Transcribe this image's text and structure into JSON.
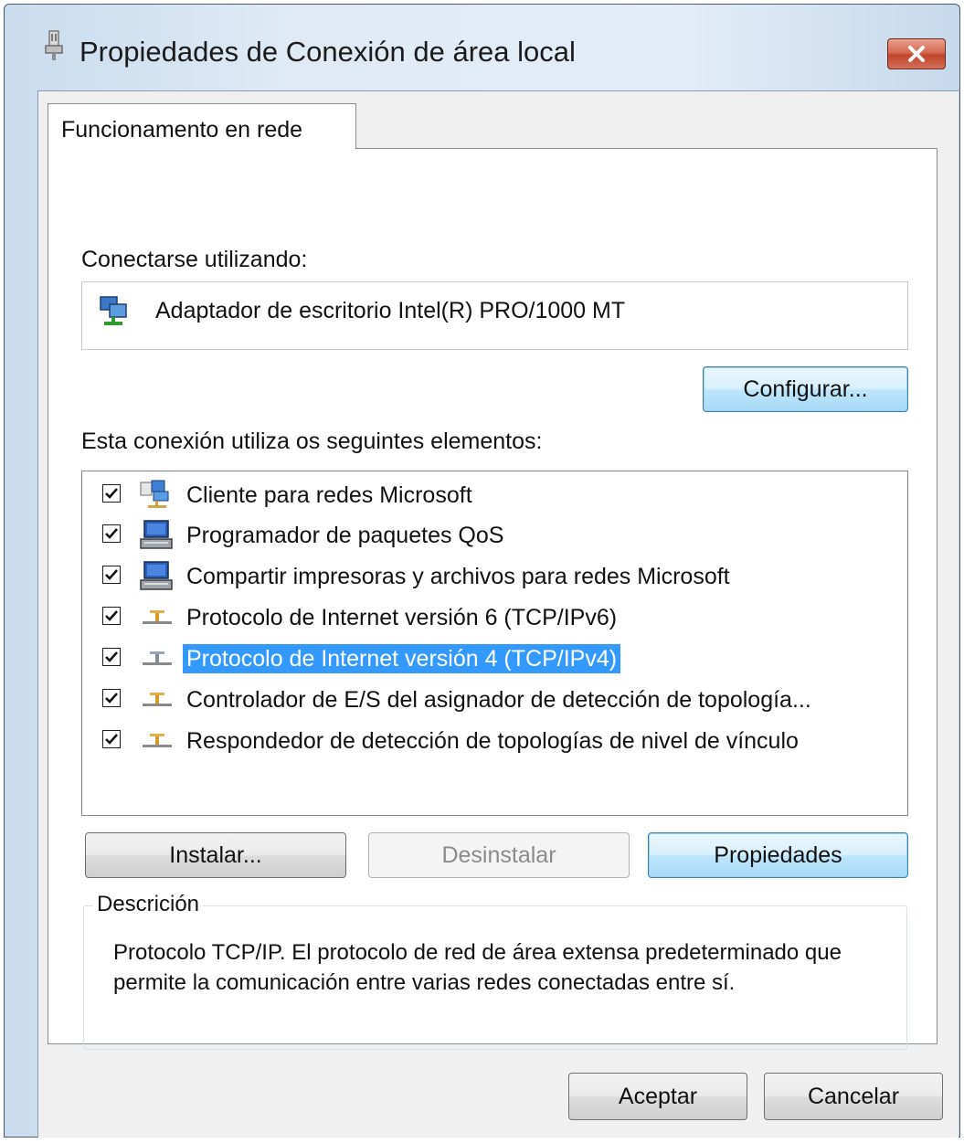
{
  "window": {
    "title": "Propiedades de Conexión de área local"
  },
  "tabs": [
    {
      "label": "Funcionamento en rede"
    }
  ],
  "panel": {
    "connect_label": "Conectarse utilizando:",
    "adapter_name": "Adaptador de escritorio Intel(R) PRO/1000 MT",
    "configure_button": "Configurar...",
    "items_label": "Esta conexión utiliza os seguintes elementos:",
    "items": [
      {
        "label": "Cliente para redes Microsoft",
        "checked": true,
        "icon": "network-client-icon"
      },
      {
        "label": "Programador de paquetes QoS",
        "checked": true,
        "icon": "network-service-icon"
      },
      {
        "label": "Compartir impresoras y archivos para redes Microsoft",
        "checked": true,
        "icon": "network-service-icon"
      },
      {
        "label": "Protocolo de Internet versión 6 (TCP/IPv6)",
        "checked": true,
        "icon": "network-protocol-icon"
      },
      {
        "label": "Protocolo de Internet versión 4 (TCP/IPv4)",
        "checked": true,
        "icon": "network-protocol-icon",
        "selected": true
      },
      {
        "label": "Controlador de E/S del asignador de detección de topología...",
        "checked": true,
        "icon": "network-protocol-icon"
      },
      {
        "label": "Respondedor de detección de topologías de nivel de vínculo",
        "checked": true,
        "icon": "network-protocol-icon"
      }
    ],
    "install_button": "Instalar...",
    "uninstall_button": "Desinstalar",
    "properties_button": "Propiedades",
    "description_legend": "Descrición",
    "description_text": "Protocolo TCP/IP. El protocolo de red de área extensa predeterminado que permite la comunicación entre varias redes conectadas entre sí."
  },
  "footer": {
    "ok_button": "Aceptar",
    "cancel_button": "Cancelar"
  },
  "colors": {
    "selection": "#3399ff",
    "close_button": "#c0432a",
    "focus_button": "#bee6fd"
  }
}
